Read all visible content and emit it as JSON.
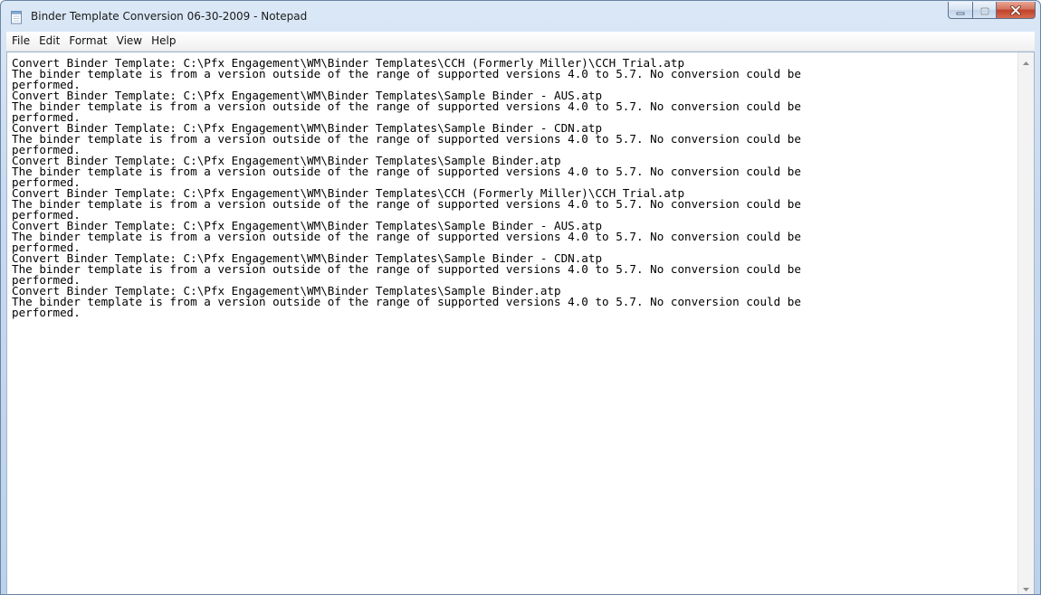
{
  "window": {
    "title": "Binder Template Conversion 06-30-2009 - Notepad"
  },
  "menu": [
    "File",
    "Edit",
    "Format",
    "View",
    "Help"
  ],
  "document": {
    "lines": [
      "Convert Binder Template: C:\\Pfx Engagement\\WM\\Binder Templates\\CCH (Formerly Miller)\\CCH Trial.atp",
      "The binder template is from a version outside of the range of supported versions 4.0 to 5.7. No conversion could be",
      "performed.",
      "Convert Binder Template: C:\\Pfx Engagement\\WM\\Binder Templates\\Sample Binder - AUS.atp",
      "The binder template is from a version outside of the range of supported versions 4.0 to 5.7. No conversion could be",
      "performed.",
      "Convert Binder Template: C:\\Pfx Engagement\\WM\\Binder Templates\\Sample Binder - CDN.atp",
      "The binder template is from a version outside of the range of supported versions 4.0 to 5.7. No conversion could be",
      "performed.",
      "Convert Binder Template: C:\\Pfx Engagement\\WM\\Binder Templates\\Sample Binder.atp",
      "The binder template is from a version outside of the range of supported versions 4.0 to 5.7. No conversion could be",
      "performed.",
      "Convert Binder Template: C:\\Pfx Engagement\\WM\\Binder Templates\\CCH (Formerly Miller)\\CCH Trial.atp",
      "The binder template is from a version outside of the range of supported versions 4.0 to 5.7. No conversion could be",
      "performed.",
      "Convert Binder Template: C:\\Pfx Engagement\\WM\\Binder Templates\\Sample Binder - AUS.atp",
      "The binder template is from a version outside of the range of supported versions 4.0 to 5.7. No conversion could be",
      "performed.",
      "Convert Binder Template: C:\\Pfx Engagement\\WM\\Binder Templates\\Sample Binder - CDN.atp",
      "The binder template is from a version outside of the range of supported versions 4.0 to 5.7. No conversion could be",
      "performed.",
      "Convert Binder Template: C:\\Pfx Engagement\\WM\\Binder Templates\\Sample Binder.atp",
      "The binder template is from a version outside of the range of supported versions 4.0 to 5.7. No conversion could be",
      "performed."
    ]
  },
  "icons": {
    "app": "notepad-icon",
    "minimize": "minimize-icon",
    "maximize": "maximize-icon",
    "close": "close-icon",
    "scroll_up": "scroll-up-arrow-icon",
    "scroll_down": "scroll-down-arrow-icon"
  },
  "colors": {
    "title_bar": "#c6d9ef",
    "close_button": "#c0412a",
    "editor_background": "#ffffff",
    "text": "#000000"
  }
}
